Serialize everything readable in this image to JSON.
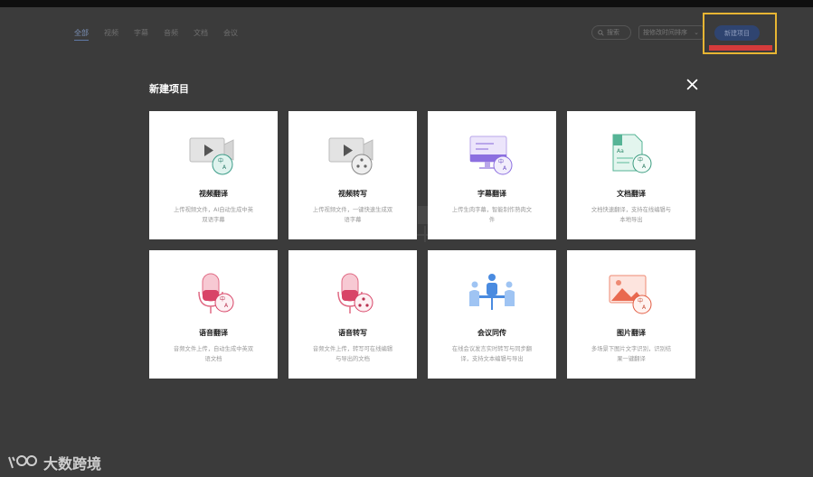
{
  "header": {
    "tabs": [
      "全部",
      "视频",
      "字幕",
      "音频",
      "文档",
      "会议"
    ],
    "search_label": "搜索",
    "sort_label": "按修改时间排序",
    "new_project_label": "新建项目"
  },
  "modal": {
    "title": "新建项目",
    "cards": [
      {
        "title": "视频翻译",
        "desc": "上传视频文件，AI自动生成中英双语字幕",
        "icon": "video-translate-icon"
      },
      {
        "title": "视频转写",
        "desc": "上传视频文件，一键快速生成双语字幕",
        "icon": "video-transcribe-icon"
      },
      {
        "title": "字幕翻译",
        "desc": "上传生肉字幕，智能制作熟肉文件",
        "icon": "subtitle-translate-icon"
      },
      {
        "title": "文档翻译",
        "desc": "文档快速翻译，支持在线编辑与本地导出",
        "icon": "document-translate-icon"
      },
      {
        "title": "语音翻译",
        "desc": "音频文件上传，自动生成中英双语文档",
        "icon": "voice-translate-icon"
      },
      {
        "title": "语音转写",
        "desc": "音频文件上传，转写可在线编辑与导出的文档",
        "icon": "voice-transcribe-icon"
      },
      {
        "title": "会议同传",
        "desc": "在线会议发言实时转写与同步翻译，支持文本编辑与导出",
        "icon": "meeting-interpret-icon"
      },
      {
        "title": "图片翻译",
        "desc": "多场景下图片文字识别，识别结果一键翻译",
        "icon": "image-translate-icon"
      }
    ]
  },
  "watermark": "大数跨境",
  "colors": {
    "highlight": "#e7b533",
    "accent": "#2f4470",
    "red": "#d43b3b"
  }
}
